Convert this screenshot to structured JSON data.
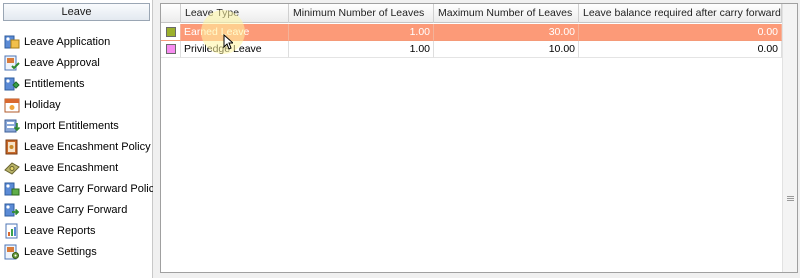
{
  "nav": {
    "header": "Leave",
    "items": [
      {
        "label": "Leave Application",
        "icon": "leave-application-icon"
      },
      {
        "label": "Leave Approval",
        "icon": "leave-approval-icon"
      },
      {
        "label": "Entitlements",
        "icon": "entitlements-icon"
      },
      {
        "label": "Holiday",
        "icon": "holiday-icon"
      },
      {
        "label": "Import Entitlements",
        "icon": "import-entitlements-icon"
      },
      {
        "label": "Leave Encashment Policy",
        "icon": "encashment-policy-icon"
      },
      {
        "label": "Leave Encashment",
        "icon": "encashment-icon"
      },
      {
        "label": "Leave Carry Forward Policy",
        "icon": "carry-forward-policy-icon"
      },
      {
        "label": "Leave Carry Forward",
        "icon": "carry-forward-icon"
      },
      {
        "label": "Leave Reports",
        "icon": "reports-icon"
      },
      {
        "label": "Leave Settings",
        "icon": "settings-icon"
      }
    ]
  },
  "grid": {
    "columns": [
      "",
      "Leave Type",
      "Minimum Number of Leaves",
      "Maximum Number of Leaves",
      "Leave balance required after carry forward"
    ],
    "rows": [
      {
        "color": "#9bb02c",
        "type": "Earned Leave",
        "min": "1.00",
        "max": "30.00",
        "balance": "0.00",
        "selected": true
      },
      {
        "color": "#f78cf0",
        "type": "Priviledge Leave",
        "min": "1.00",
        "max": "10.00",
        "balance": "0.00",
        "selected": false
      }
    ]
  }
}
